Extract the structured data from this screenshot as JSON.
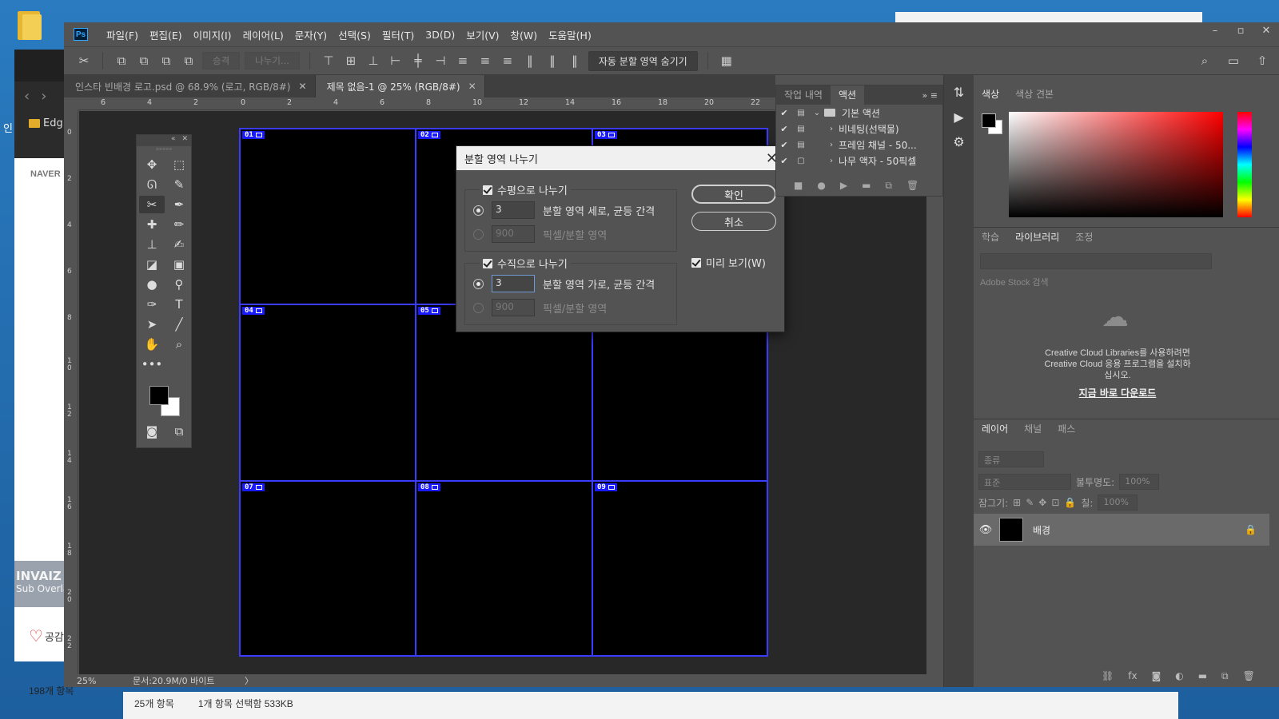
{
  "desktop": {
    "edge_side_label": "인",
    "edge_fav": "Edg",
    "naver": "NAVER",
    "overlay_title": "INVAIZ",
    "overlay_sub": "Sub Overlay",
    "heart_label": "공감",
    "item_count": "198개 항목",
    "explorer_items": "25개 항목",
    "explorer_selected": "1개 항목 선택함 533KB"
  },
  "ps": {
    "logo": "Ps",
    "menu": [
      "파일(F)",
      "편집(E)",
      "이미지(I)",
      "레이어(L)",
      "문자(Y)",
      "선택(S)",
      "필터(T)",
      "3D(D)",
      "보기(V)",
      "창(W)",
      "도움말(H)"
    ],
    "options": {
      "promote": "승격",
      "divide": "나누기...",
      "hide_auto": "자동 분할 영역 숨기기"
    },
    "tabs": [
      {
        "label": "인스타 빈배경 로고.psd @ 68.9% (로고, RGB/8#)"
      },
      {
        "label": "제목 없음-1 @ 25% (RGB/8#)"
      }
    ],
    "ruler_top": [
      "6",
      "4",
      "2",
      "0",
      "2",
      "4",
      "6",
      "8",
      "10",
      "12",
      "14",
      "16",
      "18",
      "20",
      "22"
    ],
    "ruler_left": [
      "0",
      "2",
      "4",
      "6",
      "8",
      "10",
      "12",
      "14",
      "16",
      "18",
      "20",
      "22"
    ],
    "slices": [
      "01",
      "02",
      "03",
      "04",
      "05",
      "06",
      "07",
      "08",
      "09"
    ],
    "status": {
      "zoom": "25%",
      "doc": "문서:20.9M/0 바이트",
      "arrow": "〉"
    }
  },
  "dialog": {
    "title": "분할 영역 나누기",
    "horizontal": {
      "label": "수평으로 나누기",
      "count_value": "3",
      "count_label": "분할 영역 세로, 균등 간격",
      "pixel_value": "900",
      "pixel_label": "픽셀/분할 영역"
    },
    "vertical": {
      "label": "수직으로 나누기",
      "count_value": "3",
      "count_label": "분할 영역 가로, 균등 간격",
      "pixel_value": "900",
      "pixel_label": "픽셀/분할 영역"
    },
    "ok": "확인",
    "cancel": "취소",
    "preview": "미리 보기(W)"
  },
  "actions_panel": {
    "tabs": [
      "작업 내역",
      "액션"
    ],
    "rows": [
      "기본 액션",
      "비네팅(선택물)",
      "프레임 채널 - 50...",
      "나무 액자 - 50픽셀"
    ]
  },
  "color_panel": {
    "tabs": [
      "색상",
      "색상 견본"
    ]
  },
  "library_panel": {
    "tabs": [
      "학습",
      "라이브러리",
      "조정"
    ],
    "search": "Adobe Stock 검색",
    "msg1": "Creative Cloud Libraries를 사용하려면",
    "msg2": "Creative Cloud 응용 프로그램을 설치하",
    "msg3": "십시오.",
    "link": "지금 바로 다운로드"
  },
  "layers_panel": {
    "tabs": [
      "레이어",
      "채널",
      "패스"
    ],
    "kind": "종류",
    "blend": "표준",
    "opacity_label": "불투명도:",
    "opacity": "100%",
    "lock_label": "잠그기:",
    "fill_label": "칠:",
    "fill": "100%",
    "layer_name": "배경"
  }
}
